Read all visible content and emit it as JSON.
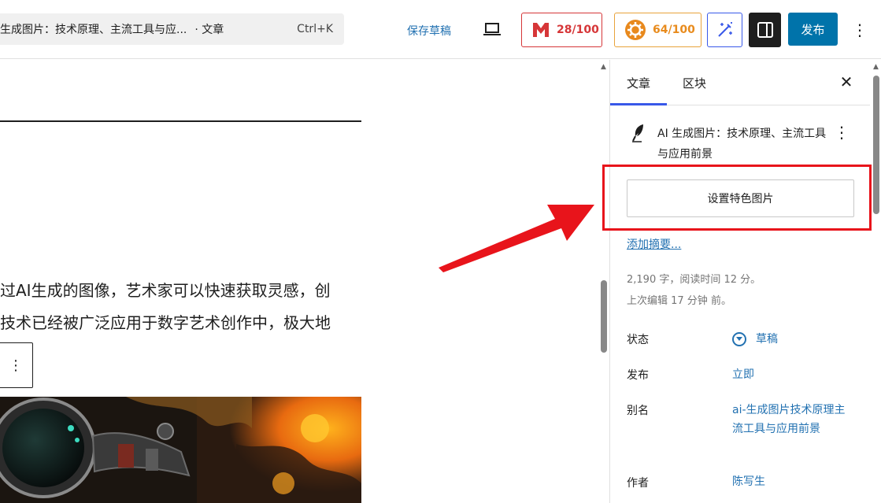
{
  "topbar": {
    "command_title": "生成图片：技术原理、主流工具与应...",
    "command_type": "· 文章",
    "command_shortcut": "Ctrl+K",
    "save_draft": "保存草稿",
    "seo_score": "28/100",
    "readability_score": "64/100",
    "publish": "发布"
  },
  "editor": {
    "paragraph_line1": "过AI生成的图像，艺术家可以快速获取灵感，创",
    "paragraph_line2": "技术已经被广泛应用于数字艺术创作中，极大地"
  },
  "sidebar": {
    "tab_article": "文章",
    "tab_block": "区块",
    "post_title": "AI 生成图片：技术原理、主流工具与应用前景",
    "featured_image_button": "设置特色图片",
    "excerpt_link": "添加摘要...",
    "stats_line1": "2,190 字，阅读时间 12 分。",
    "stats_line2": "上次编辑 17 分钟 前。",
    "status_label": "状态",
    "status_value": "草稿",
    "publish_label": "发布",
    "publish_value": "立即",
    "slug_label": "别名",
    "slug_value": "ai-生成图片技术原理主流工具与应用前景",
    "author_label": "作者",
    "author_value": "陈写生"
  },
  "colors": {
    "accent": "#3858e9",
    "publish": "#0073aa",
    "link": "#2271b1",
    "seo_red": "#d63638",
    "readability_orange": "#e88b1d",
    "annotation_red": "#e8141b"
  }
}
